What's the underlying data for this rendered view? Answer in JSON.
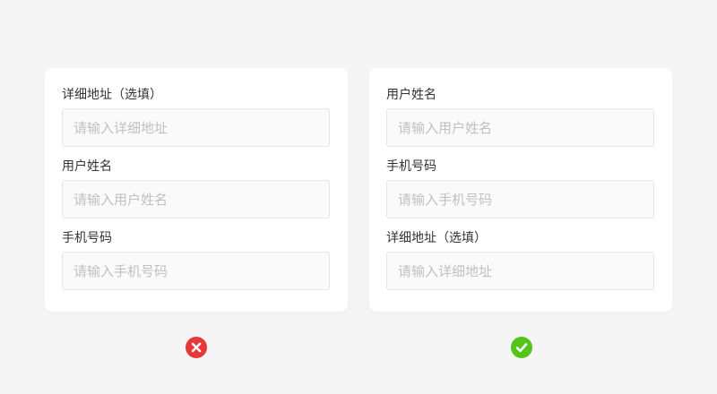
{
  "wrong_example": {
    "fields": [
      {
        "label": "详细地址（选填）",
        "placeholder": "请输入详细地址",
        "value": ""
      },
      {
        "label": "用户姓名",
        "placeholder": "请输入用户姓名",
        "value": ""
      },
      {
        "label": "手机号码",
        "placeholder": "请输入手机号码",
        "value": ""
      }
    ],
    "status_icon": "error-circle-icon",
    "status_color": "#e5383b"
  },
  "right_example": {
    "fields": [
      {
        "label": "用户姓名",
        "placeholder": "请输入用户姓名",
        "value": ""
      },
      {
        "label": "手机号码",
        "placeholder": "请输入手机号码",
        "value": ""
      },
      {
        "label": "详细地址（选填）",
        "placeholder": "请输入详细地址",
        "value": ""
      }
    ],
    "status_icon": "check-circle-icon",
    "status_color": "#52c41a"
  },
  "colors": {
    "background": "#f5f5f5",
    "card": "#ffffff",
    "input_background": "#fafafa",
    "input_border": "#e6e6e6",
    "label_text": "#333333",
    "placeholder_text": "#c0c0c0"
  }
}
